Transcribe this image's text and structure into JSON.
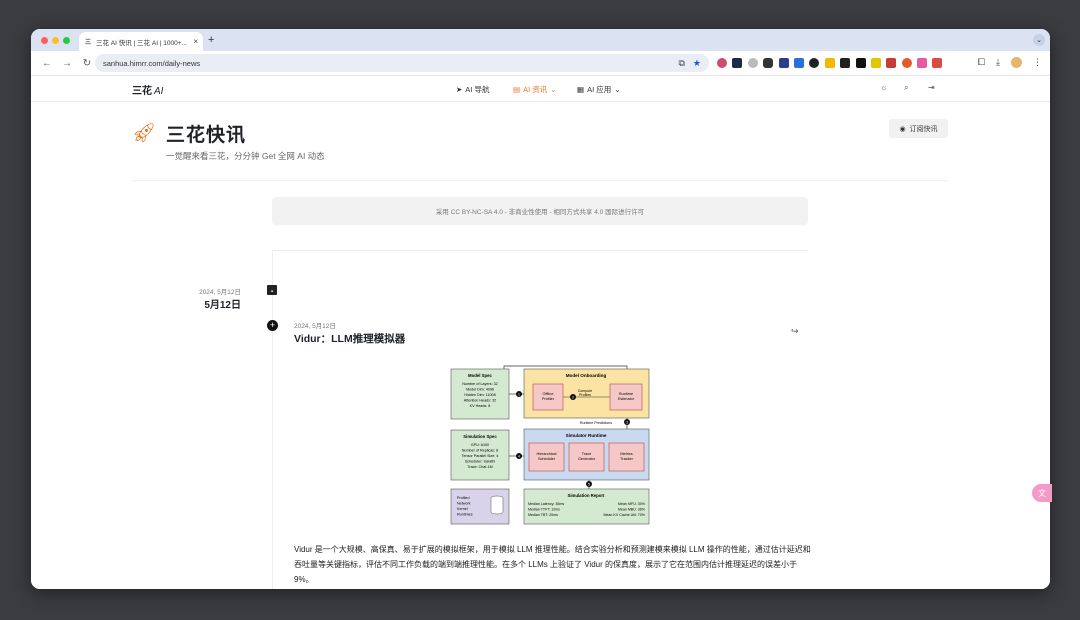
{
  "browser": {
    "tab_title": "三花 AI 快讯 | 三花 AI | 1000+...",
    "tab_favicon": "三",
    "url": "sanhua.himrr.com/daily-news",
    "new_tab": "+",
    "close": "×"
  },
  "nav": {
    "brand": "三花",
    "brand_suffix": "AI",
    "items": [
      {
        "label": "AI 导航"
      },
      {
        "label": "AI 资讯"
      },
      {
        "label": "AI 应用"
      }
    ]
  },
  "hero": {
    "title": "三花快讯",
    "subtitle": "一觉醒来看三花，分分钟 Get 全网 AI 动态",
    "subscribe": "订阅快讯"
  },
  "license": "采用 CC BY-NC-SA 4.0 - 非商业性使用 - 相同方式共享 4.0 国际进行许可",
  "timeline": {
    "date_small": "2024, 5月12日",
    "date_large": "5月12日"
  },
  "post": {
    "date": "2024, 5月12日",
    "title": "Vidur：LLM推理模拟器",
    "body": "Vidur 是一个大规模、高保真、易于扩展的模拟框架，用于模拟 LLM 推理性能。结合实验分析和预测建模来模拟 LLM 操作的性能，通过估计延迟和吞吐量等关键指标，评估不同工作负载的端到端推理性能。在多个 LLMs 上验证了 Vidur 的保真度，展示了它在范围内估计推理延迟的误差小于9%。"
  },
  "diagram": {
    "model_spec": {
      "title": "Model Spec",
      "lines": [
        "Number of Layers: 32",
        "Model Dim: 4096",
        "Hidden Dim: 11008",
        "Attention Heads: 32",
        "KV Heads: 8"
      ]
    },
    "onboarding": {
      "title": "Model Onboarding",
      "offline": [
        "Offline",
        "Profiler"
      ],
      "compute": [
        "Compute",
        "Profiles"
      ],
      "runtime": [
        "Runtime",
        "Estimator"
      ]
    },
    "predictions": "Runtime Predictions",
    "sim_spec": {
      "title": "Simulation Spec",
      "lines": [
        "GPU: A100",
        "Number of Replicas: 8",
        "Tensor Parallel Size: 4",
        "Scheduler: Sarathi",
        "Trace: Chat-1M"
      ]
    },
    "sim_runtime": {
      "title": "Simulator Runtime",
      "boxes": [
        [
          "Hierarchical",
          "Scheduler"
        ],
        [
          "Trace",
          "Generator"
        ],
        [
          "Metrics",
          "Tracker"
        ]
      ]
    },
    "profiled": [
      "Profiled",
      "Network",
      "Kernel",
      "Runtimes"
    ],
    "report": {
      "title": "Simulation Report",
      "left": [
        "Median Latency: 35ms",
        "Median TTFT: 12ms",
        "Median TBT: 20ms"
      ],
      "right": [
        "Mean MFU: 30%",
        "Mean MBU: 36%",
        "Mean KV Cache Util: 70%"
      ]
    },
    "steps": [
      "1",
      "2",
      "3",
      "4",
      "5"
    ]
  },
  "colors": {
    "accent": "#e8741f",
    "model_spec_fill": "#d4ead0",
    "onboarding_fill": "#fbe3a3",
    "inner_box_fill": "#f6c7c7",
    "sim_runtime_fill": "#c9daf0",
    "profiled_fill": "#d9d3ea",
    "report_fill": "#d4ead0"
  },
  "icons": [
    "shield-icon",
    "star-icon",
    "download-icon",
    "extensions-icon",
    "rocket-icon",
    "chat-icon",
    "calendar-icon",
    "plus-circle-icon",
    "share-icon",
    "sun-icon",
    "search-icon",
    "login-icon"
  ]
}
